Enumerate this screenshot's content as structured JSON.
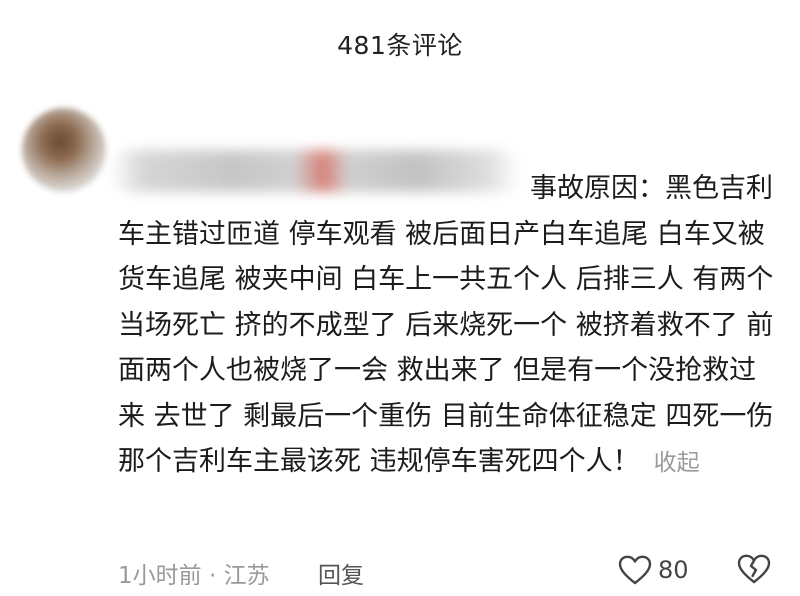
{
  "header": {
    "title": "481条评论"
  },
  "comment": {
    "text": "事故原因：黑色吉利车主错过匝道 停车观看 被后面日产白车追尾 白车又被货车追尾 被夹中间 白车上一共五个人 后排三人 有两个当场死亡 挤的不成型了 后来烧死一个 被挤着救不了 前面两个人也被烧了一会 救出来了 但是有一个没抢救过来 去世了 剩最后一个重伤 目前生命体征稳定  四死一伤 那个吉利车主最该死 违规停车害死四个人！",
    "collapse_label": "收起",
    "time_location": "1小时前 · 江苏",
    "reply_label": "回复",
    "like_count": "80"
  },
  "icons": {
    "like": "heart-outline-icon",
    "dislike": "broken-heart-icon"
  },
  "colors": {
    "text": "#1c1c1c",
    "muted": "#9a9a9a",
    "background": "#ffffff"
  }
}
